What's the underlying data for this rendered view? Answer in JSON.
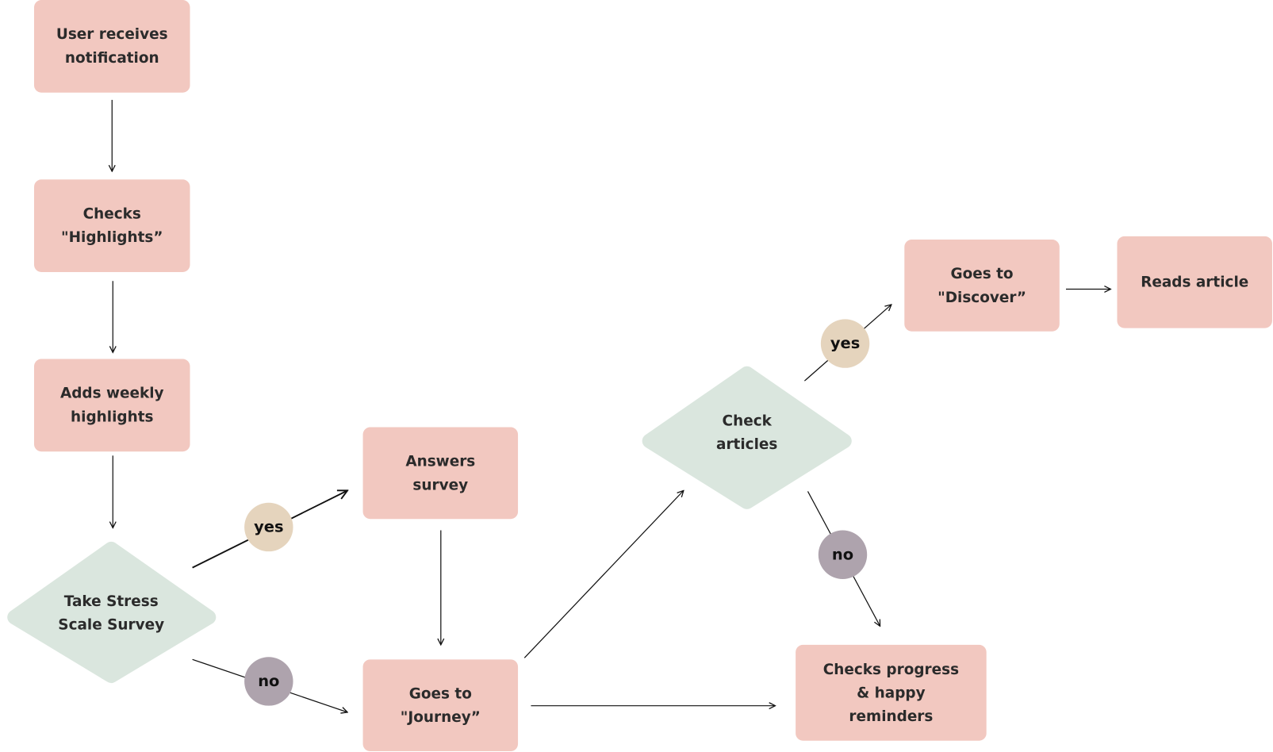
{
  "colors": {
    "process": "#F2C8C0",
    "decision": "#DAE6DE",
    "yes": "#E5D4BD",
    "no": "#AEA3AD"
  },
  "nodes": {
    "notification": "User receives\nnotification",
    "highlights": "Checks\n\"Highlights”",
    "weekly": "Adds weekly\nhighlights",
    "survey_decision": "Take Stress\nScale Survey",
    "answers": "Answers\nsurvey",
    "journey": "Goes to\n\"Journey”",
    "articles_decision": "Check\narticles",
    "discover": "Goes to\n\"Discover”",
    "reads": "Reads article",
    "progress": "Checks progress\n& happy\nreminders"
  },
  "branches": {
    "yes1": "yes",
    "no1": "no",
    "yes2": "yes",
    "no2": "no"
  }
}
